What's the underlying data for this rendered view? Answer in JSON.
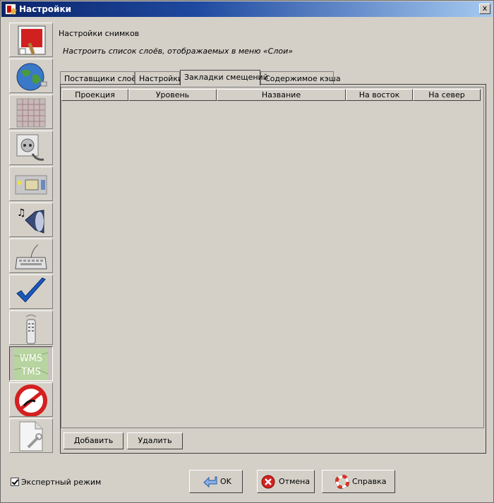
{
  "window": {
    "title": "Настройки",
    "close_label": "x"
  },
  "sidebar": {
    "items": [
      {
        "name": "appearance"
      },
      {
        "name": "map"
      },
      {
        "name": "imagery"
      },
      {
        "name": "connection"
      },
      {
        "name": "files"
      },
      {
        "name": "sound"
      },
      {
        "name": "keyboard"
      },
      {
        "name": "validator"
      },
      {
        "name": "remote-control"
      },
      {
        "name": "wms-tms",
        "label_top": "WMS",
        "label_bottom": "TMS"
      },
      {
        "name": "plugins"
      },
      {
        "name": "advanced"
      }
    ]
  },
  "header": {
    "title": "Настройки снимков",
    "description": "Настроить список слоёв, отображаемых в меню «Слои»"
  },
  "tabs": [
    {
      "label": "Поставщики слоёв"
    },
    {
      "label": "Настройки"
    },
    {
      "label": "Закладки смещений",
      "active": true
    },
    {
      "label": "Содержимое кэша"
    }
  ],
  "table": {
    "columns": [
      "Проекция",
      "Уровень",
      "Название",
      "На восток",
      "На север"
    ],
    "rows": []
  },
  "panel_buttons": {
    "add": "Добавить",
    "remove": "Удалить"
  },
  "footer": {
    "expert_mode": {
      "label": "Экспертный режим",
      "checked": true
    },
    "ok": "OK",
    "cancel": "Отмена",
    "help": "Справка"
  },
  "colors": {
    "background": "#d4d0c8",
    "title_gradient_start": "#0a246a",
    "title_gradient_end": "#a6caf0",
    "cancel_icon": "#d42020",
    "help_icon": "#e03020"
  },
  "icons": {
    "close": "close-icon",
    "ok": "arrow-icon",
    "cancel": "cancel-icon",
    "help": "lifebuoy-icon"
  }
}
